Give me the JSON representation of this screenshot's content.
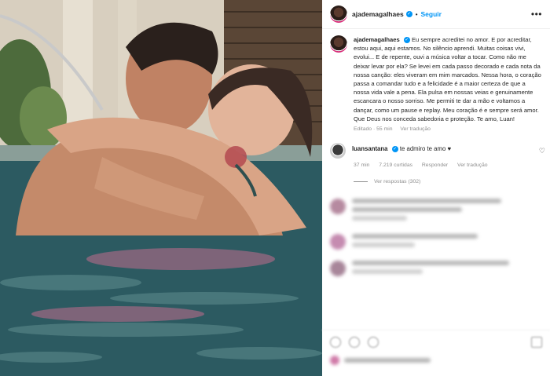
{
  "photo": {
    "description_icon": "photo-image"
  },
  "header": {
    "username": "ajademagalhaes",
    "separator": "•",
    "follow_label": "Seguir",
    "more_icon": "more-dots-icon"
  },
  "caption": {
    "username": "ajademagalhaes",
    "text": "Eu sempre acreditei no amor. E por acreditar, estou aqui, aqui estamos. No silêncio aprendi. Muitas coisas vivi, evolui... E de repente, ouvi a música voltar a tocar. Como não me deixar levar por ela? Se levei em cada passo decorado e cada nota da nossa canção: eles viveram em mim marcados. Nessa hora, o coração passa a comandar tudo e a felicidade é a maior certeza de que a nossa vida vale a pena. Ela pulsa em nossas veias e genuinamente escancara o nosso sorriso. Me permiti te dar a mão e voltamos a dançar, como um pause e replay. Meu coração é e sempre será amor. Que Deus nos conceda sabedoria e proteção. Te amo, Luan!",
    "edited": "Editado · 55 min",
    "see_translation": "Ver tradução"
  },
  "comment": {
    "username": "luansantana",
    "text": "te admiro te amo ♥",
    "time": "37 min",
    "likes": "7.219 curtidas",
    "reply": "Responder",
    "see_translation": "Ver tradução",
    "view_replies": "Ver respostas (302)"
  },
  "colors": {
    "accent": "#0095f6",
    "secondary_text": "#8e8e8e",
    "primary_text": "#262626"
  }
}
